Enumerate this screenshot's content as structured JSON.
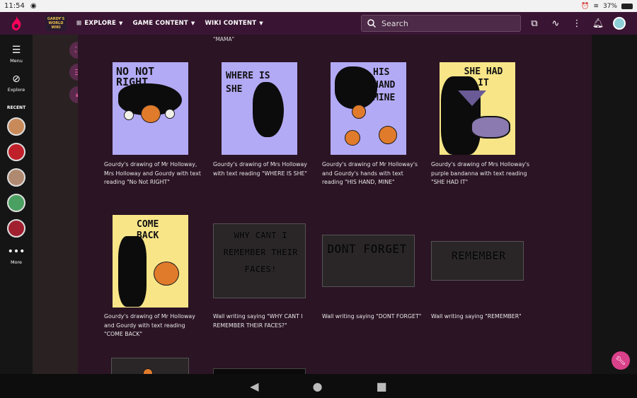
{
  "status": {
    "time": "11:54",
    "battery": "37%"
  },
  "nav": {
    "wiki_logo": "GARDY'S WORLD WIKI",
    "explore": "EXPLORE",
    "game_content": "GAME CONTENT",
    "wiki_content": "WIKI CONTENT",
    "search_placeholder": "Search"
  },
  "rail": {
    "menu": "Menu",
    "explore": "Explore",
    "recent": "RECENT",
    "more": "More"
  },
  "content": {
    "partial_caption": "\"MAMA\"",
    "gallery": [
      {
        "caption": "Gourdy's drawing of Mr Holloway, Mrs Holloway and Gourdy with text reading \"No Not RIGHT\"",
        "art_text": "NO NOT RIGHT"
      },
      {
        "caption": "Gourdy's drawing of Mrs Holloway with text reading \"WHERE IS SHE\"",
        "art_text": "WHERE IS SHE"
      },
      {
        "caption": "Gourdy's drawing of Mr Holloway's and Gourdy's hands with text reading \"HIS HAND, MINE\"",
        "art_text": "HIS HAND MINE"
      },
      {
        "caption": "Gourdy's drawing of Mrs Holloway's purple bandanna with text reading \"SHE HAD IT\"",
        "art_text": "SHE HAD IT"
      },
      {
        "caption": "Gourdy's drawing of Mr Holloway and Gourdy with text reading \"COME BACK\"",
        "art_text": "COME BACK"
      },
      {
        "caption": "Wall writing saying \"WHY CANT I REMEMBER THEIR FACES?\"",
        "art_text": "WHY CANT I REMEMBER THEIR FACES!"
      },
      {
        "caption": "Wall writing saying \"DONT FORGET\"",
        "art_text": "DONT FORGET"
      },
      {
        "caption": "Wall writing saying \"REMEMBER\"",
        "art_text": "REMEMBER"
      }
    ]
  },
  "colors": {
    "topnav": "#3a1533",
    "content_bg": "#2b1424",
    "accent": "#d9418a"
  }
}
